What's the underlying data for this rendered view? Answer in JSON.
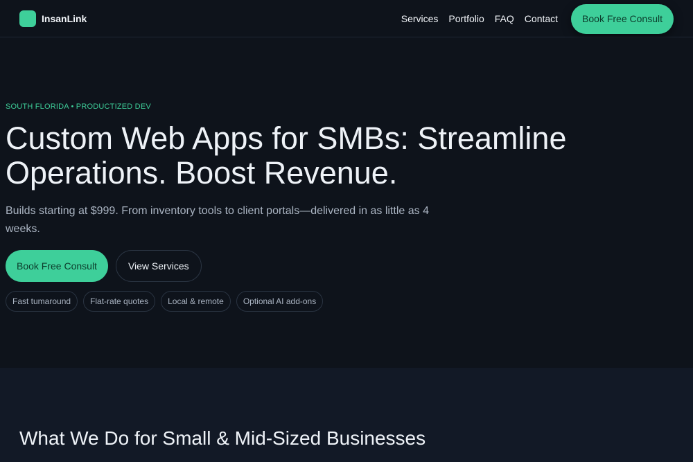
{
  "header": {
    "brand_name": "InsanLink",
    "nav": [
      "Services",
      "Portfolio",
      "FAQ",
      "Contact"
    ],
    "cta_label": "Book Free Consult"
  },
  "hero": {
    "eyebrow": "SOUTH FLORIDA • PRODUCTIZED DEV",
    "title": "Custom Web Apps for SMBs: Streamline Operations. Boost Revenue.",
    "subtitle": "Builds starting at $999. From inventory tools to client portals—delivered in as little as 4 weeks.",
    "primary_label": "Book Free Consult",
    "secondary_label": "View Services",
    "chips": [
      "Fast tumaround",
      "Flat-rate quotes",
      "Local & remote",
      "Optional AI add-ons"
    ]
  },
  "section": {
    "title": "What We Do for Small & Mid-Sized Businesses"
  },
  "colors": {
    "background": "#0e131b",
    "accent": "#3ecf9a",
    "section_background": "#121926"
  }
}
